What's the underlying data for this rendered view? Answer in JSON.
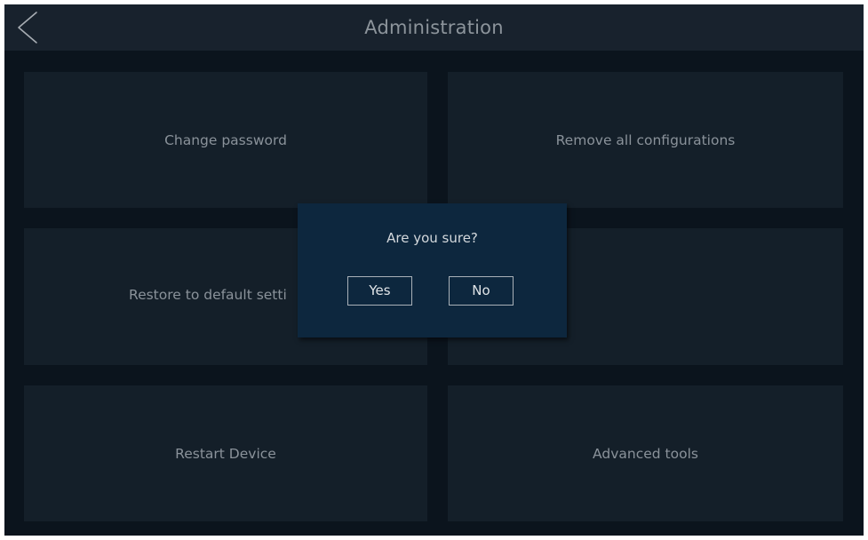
{
  "header": {
    "title": "Administration",
    "back_icon": "chevron-left-icon"
  },
  "tiles": [
    {
      "label": "Change password"
    },
    {
      "label": "Remove all configurations"
    },
    {
      "label": "Restore to default setti"
    },
    {
      "label": ""
    },
    {
      "label": "Restart Device"
    },
    {
      "label": "Advanced tools"
    }
  ],
  "dialog": {
    "message": "Are you sure?",
    "yes_label": "Yes",
    "no_label": "No"
  },
  "colors": {
    "background": "#0b141d",
    "header": "#18222d",
    "tile": "#141f29",
    "dialog": "#0d273e",
    "text_muted": "#8a929a",
    "text_light": "#d3d8dc"
  }
}
